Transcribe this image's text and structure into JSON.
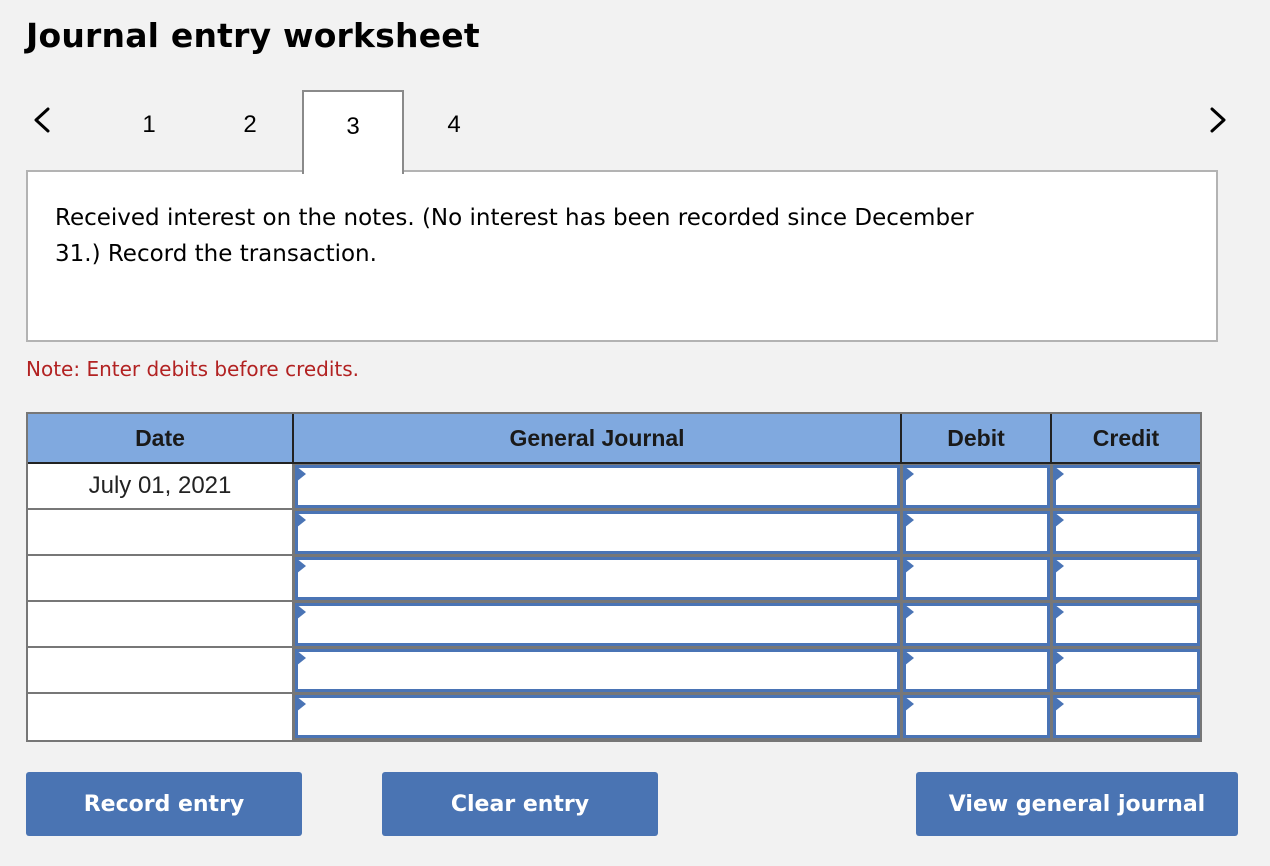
{
  "header": {
    "title": "Journal entry worksheet"
  },
  "tabs": {
    "prev_icon": "chevron-left-icon",
    "next_icon": "chevron-right-icon",
    "items": [
      {
        "label": "1",
        "active": false
      },
      {
        "label": "2",
        "active": false
      },
      {
        "label": "3",
        "active": true
      },
      {
        "label": "4",
        "active": false
      }
    ]
  },
  "prompt": {
    "text": "Received interest on the notes. (No interest has been recorded since December 31.) Record the transaction."
  },
  "note": {
    "text": "Note: Enter debits before credits.",
    "color": "#b22222"
  },
  "journal": {
    "columns": [
      "Date",
      "General Journal",
      "Debit",
      "Credit"
    ],
    "rows": [
      {
        "date": "July 01, 2021",
        "account": "",
        "debit": "",
        "credit": ""
      },
      {
        "date": "",
        "account": "",
        "debit": "",
        "credit": ""
      },
      {
        "date": "",
        "account": "",
        "debit": "",
        "credit": ""
      },
      {
        "date": "",
        "account": "",
        "debit": "",
        "credit": ""
      },
      {
        "date": "",
        "account": "",
        "debit": "",
        "credit": ""
      },
      {
        "date": "",
        "account": "",
        "debit": "",
        "credit": ""
      }
    ],
    "header_color": "#80a9df",
    "input_border_color": "#4a74b5"
  },
  "buttons": {
    "record": "Record entry",
    "clear": "Clear entry",
    "view": "View general journal",
    "color": "#4a74b3"
  }
}
